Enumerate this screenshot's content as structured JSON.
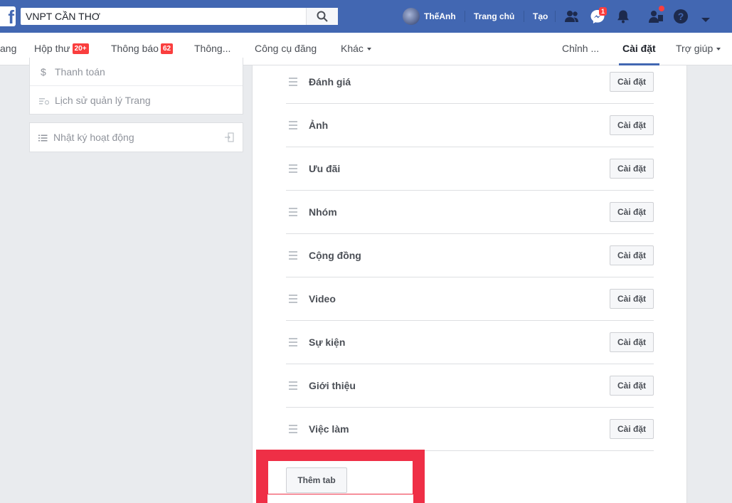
{
  "topbar": {
    "logo": "f",
    "search_value": "VNPT CẦN THƠ",
    "profile_name": "ThếAnh",
    "home": "Trang chủ",
    "create": "Tạo",
    "messages_count": "1"
  },
  "subnav": {
    "partial_left": "ang",
    "inbox": "Hộp thư",
    "inbox_count": "20+",
    "notifications": "Thông báo",
    "notifications_count": "62",
    "insights": "Thông...",
    "publishing_tools": "Công cụ đăng",
    "more": "Khác",
    "edit": "Chỉnh ...",
    "settings": "Cài đặt",
    "help": "Trợ giúp"
  },
  "sidebar": {
    "payments": "Thanh toán",
    "page_history": "Lịch sử quản lý Trang",
    "activity_log": "Nhật ký hoạt động"
  },
  "tabs": [
    {
      "name": "Đánh giá",
      "button": "Cài đặt"
    },
    {
      "name": "Ảnh",
      "button": "Cài đặt"
    },
    {
      "name": "Ưu đãi",
      "button": "Cài đặt"
    },
    {
      "name": "Nhóm",
      "button": "Cài đặt"
    },
    {
      "name": "Cộng đồng",
      "button": "Cài đặt"
    },
    {
      "name": "Video",
      "button": "Cài đặt"
    },
    {
      "name": "Sự kiện",
      "button": "Cài đặt"
    },
    {
      "name": "Giới thiệu",
      "button": "Cài đặt"
    },
    {
      "name": "Việc làm",
      "button": "Cài đặt"
    }
  ],
  "add_tab": "Thêm tab",
  "colors": {
    "brand": "#4267b2",
    "highlight": "#ef2f46"
  }
}
